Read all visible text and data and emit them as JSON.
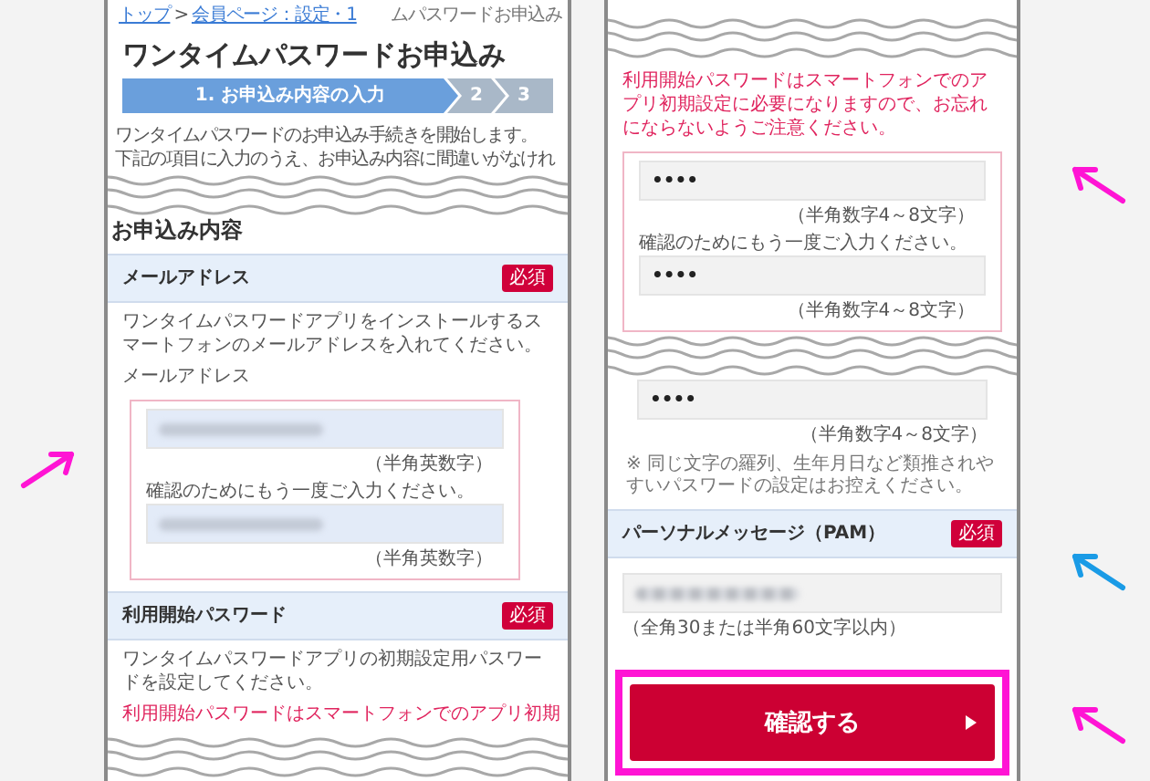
{
  "left_panel": {
    "breadcrumb": [
      {
        "label": "トップ",
        "kind": "link"
      },
      {
        "label": ">",
        "kind": "separator"
      },
      {
        "label": "会員ページ：設定・1",
        "kind": "link"
      },
      {
        "label": "ムパスワードお申込み",
        "kind": "current"
      }
    ],
    "title": "ワンタイムパスワードお申込み",
    "steps": [
      {
        "label": "1. お申込み内容の入力",
        "selected": true
      },
      {
        "label": "2",
        "selected": false
      },
      {
        "label": "3",
        "selected": false
      }
    ],
    "intro": [
      "ワンタイムパスワードのお申込み手続きを開始します。",
      "下記の項目に入力のうえ、お申込み内容に間違いがなけれ"
    ],
    "section_title": "お申込み内容",
    "email": {
      "title": "メールアドレス",
      "badge": "必須",
      "description": "ワンタイムパスワードアプリをインストールするスマートフォンのメールアドレスを入れてください。",
      "field_label": "メールアドレス",
      "hint": "（半角英数字）",
      "confirm_label": "確認のためにもう一度ご入力ください。",
      "confirm_hint": "（半角英数字）"
    },
    "password": {
      "title": "利用開始パスワード",
      "badge": "必須",
      "description": "ワンタイムパスワードアプリの初期設定用パスワードを設定してください。",
      "warning": "利用開始パスワードはスマートフォンでのアプリ初期"
    }
  },
  "right_panel": {
    "warning": "利用開始パスワードはスマートフォンでのアプリ初期設定に必要になりますので、お忘れにならないようご注意ください。",
    "password_value": "••••",
    "hint": "（半角数字4～8文字）",
    "confirm_label": "確認のためにもう一度ご入力ください。",
    "confirm_value": "••••",
    "confirm_hint": "（半角数字4～8文字）",
    "repeat_value": "••••",
    "repeat_hint": "（半角数字4～8文字）",
    "note": "※ 同じ文字の羅列、生年月日など類推されやすいパスワードの設定はお控えください。",
    "pam": {
      "title": "パーソナルメッセージ（PAM）",
      "badge": "必須",
      "hint": "（全角30または半角60文字以内）"
    },
    "confirm_button": "確認する"
  },
  "arrows": [
    {
      "color": "#ff14d4"
    },
    {
      "color": "#ff14d4"
    },
    {
      "color": "#1a9be6"
    },
    {
      "color": "#ff14d4"
    }
  ]
}
